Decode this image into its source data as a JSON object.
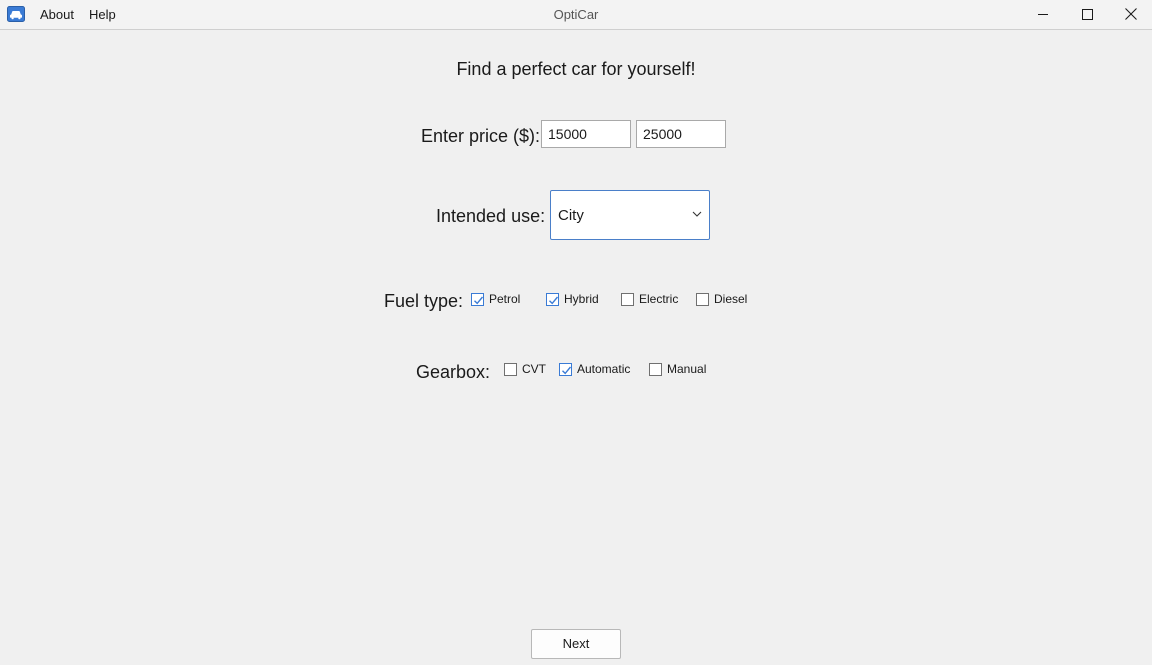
{
  "window": {
    "title": "OptiCar",
    "app_icon": "car-icon",
    "controls": [
      "minimize-icon",
      "maximize-icon",
      "close-icon"
    ]
  },
  "menu": {
    "about": "About",
    "help": "Help"
  },
  "main": {
    "heading": "Find a perfect car for yourself!",
    "price": {
      "label": "Enter price ($):",
      "min": "15000",
      "max": "25000"
    },
    "intended_use": {
      "label": "Intended use:",
      "selected": "City",
      "icon": "chevron-down-icon"
    },
    "fuel": {
      "label": "Fuel type:",
      "options": [
        {
          "label": "Petrol",
          "checked": true
        },
        {
          "label": "Hybrid",
          "checked": true
        },
        {
          "label": "Electric",
          "checked": false
        },
        {
          "label": "Diesel",
          "checked": false
        }
      ]
    },
    "gearbox": {
      "label": "Gearbox:",
      "options": [
        {
          "label": "CVT",
          "checked": false
        },
        {
          "label": "Automatic",
          "checked": true
        },
        {
          "label": "Manual",
          "checked": false
        }
      ]
    },
    "next_label": "Next"
  },
  "colors": {
    "accent": "#3a7bd5",
    "background": "#f0f0f0"
  }
}
